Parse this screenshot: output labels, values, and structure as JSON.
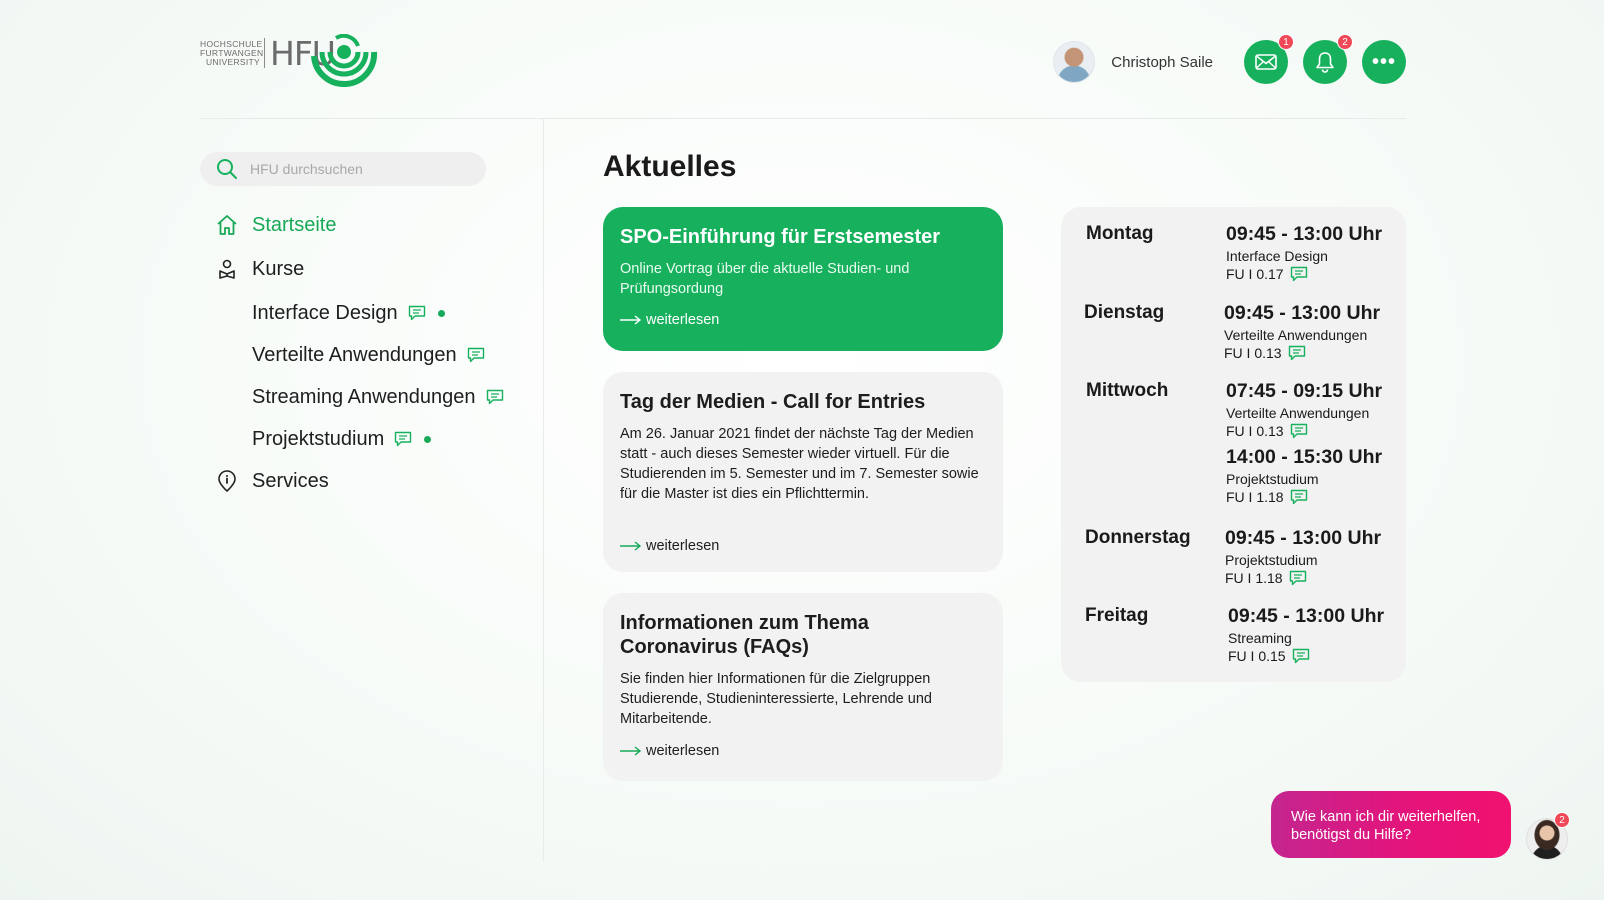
{
  "brand": {
    "logo_small_lines": [
      "HOCHSCHULE",
      "FURTWANGEN",
      "UNIVERSITY"
    ],
    "logo_text": "HFU",
    "primary_color": "#17b15e",
    "accent_color": "#e6137a",
    "badge_color": "#ef4857"
  },
  "header": {
    "user_name": "Christoph Saile",
    "mail_badge": "1",
    "notifications_badge": "2",
    "icons": [
      "mail-icon",
      "bell-icon",
      "more-icon"
    ]
  },
  "sidebar": {
    "search_placeholder": "HFU durchsuchen",
    "nav": {
      "home": "Startseite",
      "courses": "Kurse",
      "services": "Services"
    },
    "courses": [
      {
        "label": "Interface Design",
        "unread": true
      },
      {
        "label": "Verteilte Anwendungen",
        "unread": false
      },
      {
        "label": "Streaming Anwendungen",
        "unread": false
      },
      {
        "label": "Projektstudium",
        "unread": true
      }
    ]
  },
  "main": {
    "title": "Aktuelles",
    "news": [
      {
        "title": "SPO-Einführung für Erstsemester",
        "text": "Online Vortrag über die aktuelle Studien- und Prüfungsordung",
        "link": "weiterlesen",
        "highlighted": true
      },
      {
        "title": "Tag der Medien - Call for Entries",
        "text": "Am 26. Januar 2021 findet der nächste Tag der Medien statt - auch dieses Semester wieder virtuell. Für die Studierenden im 5. Semester und im 7. Semester sowie für die Master ist dies ein Pflichttermin.",
        "link": "weiterlesen",
        "highlighted": false
      },
      {
        "title": "Informationen zum Thema Coronavirus (FAQs)",
        "text": "Sie finden hier Informationen für die Zielgruppen Studierende, Studieninteressierte, Lehrende und Mitarbeitende.",
        "link": "weiterlesen",
        "highlighted": false
      }
    ]
  },
  "schedule": {
    "days": [
      {
        "day": "Montag",
        "slots": [
          {
            "time": "09:45 - 13:00 Uhr",
            "course": "Interface Design",
            "room": "FU I 0.17"
          }
        ]
      },
      {
        "day": "Dienstag",
        "slots": [
          {
            "time": "09:45 - 13:00 Uhr",
            "course": "Verteilte Anwendungen",
            "room": "FU I 0.13"
          }
        ]
      },
      {
        "day": "Mittwoch",
        "slots": [
          {
            "time": "07:45 - 09:15 Uhr",
            "course": "Verteilte Anwendungen",
            "room": "FU I 0.13"
          },
          {
            "time": "14:00 - 15:30 Uhr",
            "course": "Projektstudium",
            "room": "FU I 1.18"
          }
        ]
      },
      {
        "day": "Donnerstag",
        "slots": [
          {
            "time": "09:45 - 13:00 Uhr",
            "course": "Projektstudium",
            "room": "FU I 1.18"
          }
        ]
      },
      {
        "day": "Freitag",
        "slots": [
          {
            "time": "09:45 - 13:00 Uhr",
            "course": "Streaming",
            "room": "FU I 0.15"
          }
        ]
      }
    ]
  },
  "chatbot": {
    "message": "Wie kann ich dir weiterhelfen, benötigst du Hilfe?",
    "badge": "2"
  }
}
